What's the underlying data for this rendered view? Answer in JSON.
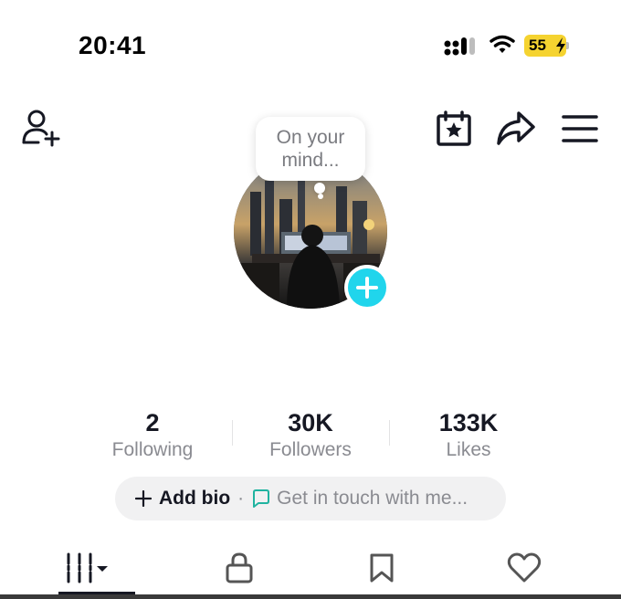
{
  "status_bar": {
    "time": "20:41",
    "battery": "55",
    "icons": [
      "cellular-signal-icon",
      "wifi-icon",
      "battery-charging-icon"
    ]
  },
  "header": {
    "icons": [
      "add-friend-icon",
      "calendar-star-icon",
      "share-icon",
      "menu-icon"
    ]
  },
  "avatar": {
    "bubble_line1": "On your",
    "bubble_line2": "mind...",
    "add_icon": "plus-icon"
  },
  "stats": {
    "following": {
      "value": "2",
      "label": "Following"
    },
    "followers": {
      "value": "30K",
      "label": "Followers"
    },
    "likes": {
      "value": "133K",
      "label": "Likes"
    }
  },
  "bio": {
    "add_label": "Add bio",
    "separator": "·",
    "contact_label": "Get in touch with me..."
  },
  "tabs": {
    "items": [
      "videos-grid-icon",
      "lock-icon",
      "bookmark-icon",
      "heart-icon"
    ],
    "active": "videos-grid-icon"
  },
  "colors": {
    "accent": "#20d5ec",
    "bio_chat": "#20b3a0",
    "battery": "#f5d330",
    "muted_text": "#8a8b91"
  }
}
